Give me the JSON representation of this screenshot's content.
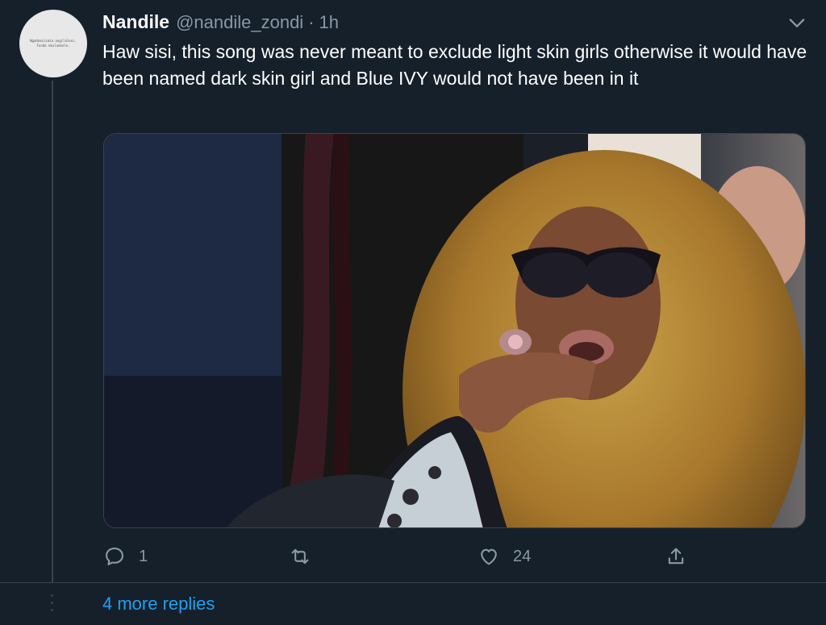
{
  "tweet": {
    "author_name": "Nandile",
    "handle": "@nandile_zondi",
    "separator": "·",
    "time": "1h",
    "text": "Haw sisi, this song was never meant to exclude light skin girls otherwise it would have been named dark skin girl and Blue IVY would not have been in it",
    "avatar_text": "Ngabhazisaza angilaleni. Funda nkulunkele.",
    "reply_count": "1",
    "retweet_count": "",
    "like_count": "24"
  },
  "icons": {
    "caret": "chevron-down-icon",
    "reply": "reply-icon",
    "retweet": "retweet-icon",
    "like": "heart-icon",
    "share": "share-icon"
  },
  "thread": {
    "more_replies": "4 more replies"
  },
  "colors": {
    "background": "#15202b",
    "secondary_text": "#8899a6",
    "link": "#1da1f2",
    "border": "#38444d"
  }
}
